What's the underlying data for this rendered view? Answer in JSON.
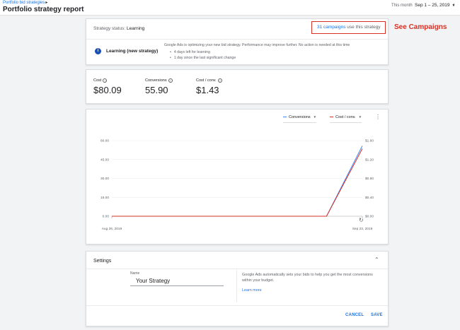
{
  "header": {
    "breadcrumb": "Portfolio bid strategies",
    "title": "Portfolio strategy report",
    "date_label": "This month",
    "date_range": "Sep 1 – 25, 2019"
  },
  "status": {
    "label": "Strategy status:",
    "value": "Learning",
    "campaigns_count": "31 campaigns",
    "campaigns_suffix": " use this strategy",
    "annotation": "See Campaigns",
    "learning_title": "Learning (new strategy)",
    "learning_desc": "Google Ads is optimizing your new bid strategy. Performance may improve further. No action is needed at this time",
    "learning_points": [
      "4 days left for learning",
      "1 day since the last significant change"
    ]
  },
  "metrics": [
    {
      "label": "Cost",
      "value": "$80.09"
    },
    {
      "label": "Conversions",
      "value": "55.90"
    },
    {
      "label": "Cost / conv.",
      "value": "$1.43"
    }
  ],
  "legend": [
    {
      "name": "Conversions",
      "color": "#4285f4"
    },
    {
      "name": "Cost / conv.",
      "color": "#d93025"
    }
  ],
  "chart_data": {
    "type": "line",
    "x": [
      "Aug 26, 2019",
      "Sep 19, 2019",
      "Sep 23, 2019"
    ],
    "x_tick_labels": [
      "Aug 26, 2019",
      "Sep 23, 2019"
    ],
    "left_ticks": [
      "60.00",
      "45.00",
      "30.00",
      "15.00",
      "0.00"
    ],
    "right_ticks": [
      "$1.60",
      "$1.20",
      "$0.80",
      "$0.40",
      "$0.00"
    ],
    "ylim_left": [
      0,
      60
    ],
    "ylim_right": [
      0,
      1.6
    ],
    "grid": true,
    "series": [
      {
        "name": "Conversions",
        "axis": "left",
        "color": "#4285f4",
        "values": [
          0,
          0,
          55.9
        ]
      },
      {
        "name": "Cost / conv.",
        "axis": "right",
        "color": "#d93025",
        "values": [
          0,
          0,
          1.43
        ]
      }
    ]
  },
  "settings": {
    "title": "Settings",
    "name_label": "Name",
    "name_value": "Your Strategy",
    "description": "Google Ads automatically sets your bids to help you get the most conversions within your budget.",
    "learn_more": "Learn more",
    "cancel": "CANCEL",
    "save": "SAVE"
  }
}
